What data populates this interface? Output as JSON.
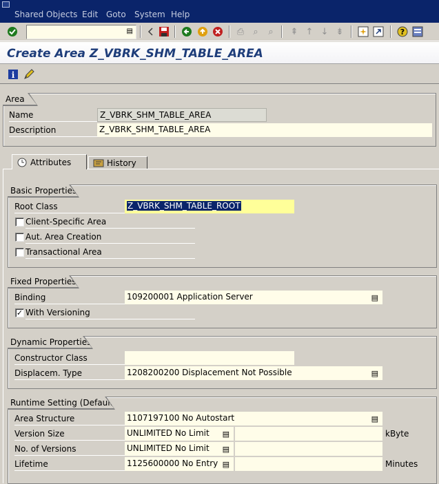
{
  "menu": {
    "items": [
      "Shared Objects",
      "Edit",
      "Goto",
      "System",
      "Help"
    ]
  },
  "toolbar": {
    "command_value": "",
    "icons": [
      "enter-icon",
      "back-arrow-icon",
      "save-icon",
      "back-icon",
      "exit-icon",
      "cancel-icon",
      "print-icon",
      "find-icon",
      "find-next-icon",
      "first-page-icon",
      "previous-page-icon",
      "next-page-icon",
      "last-page-icon",
      "create-session-icon",
      "shortcut-icon",
      "help-icon",
      "layout-icon"
    ]
  },
  "title": "Create Area Z_VBRK_SHM_TABLE_AREA",
  "area": {
    "group_title": "Area",
    "name_label": "Name",
    "name_value": "Z_VBRK_SHM_TABLE_AREA",
    "description_label": "Description",
    "description_value": "Z_VBRK_SHM_TABLE_AREA"
  },
  "tabs": [
    {
      "label": "Attributes",
      "active": true
    },
    {
      "label": "History",
      "active": false
    }
  ],
  "basic": {
    "group_title": "Basic Properties",
    "root_class_label": "Root Class",
    "root_class_value": "Z_VBRK_SHM_TABLE_ROOT",
    "client_specific_label": "Client-Specific Area",
    "client_specific_checked": false,
    "aut_area_label": "Aut. Area Creation",
    "aut_area_checked": false,
    "transactional_label": "Transactional Area",
    "transactional_checked": false
  },
  "fixed": {
    "group_title": "Fixed Properties",
    "binding_label": "Binding",
    "binding_value": "109200001 Application Server",
    "versioning_label": "With Versioning",
    "versioning_checked": true
  },
  "dynamic": {
    "group_title": "Dynamic Properties",
    "constructor_label": "Constructor Class",
    "constructor_value": "",
    "displacement_label": "Displacem. Type",
    "displacement_value": "1208200200 Displacement Not Possible"
  },
  "runtime": {
    "group_title": "Runtime Setting (Default)",
    "area_structure_label": "Area Structure",
    "area_structure_value": "1107197100 No Autostart",
    "version_size_label": "Version Size",
    "version_size_value": "UNLIMITED No Limit",
    "version_size_unit": "kByte",
    "versions_label": "No. of Versions",
    "versions_value": "UNLIMITED No Limit",
    "lifetime_label": "Lifetime",
    "lifetime_value": "1125600000 No Entry",
    "lifetime_unit": "Minutes"
  }
}
